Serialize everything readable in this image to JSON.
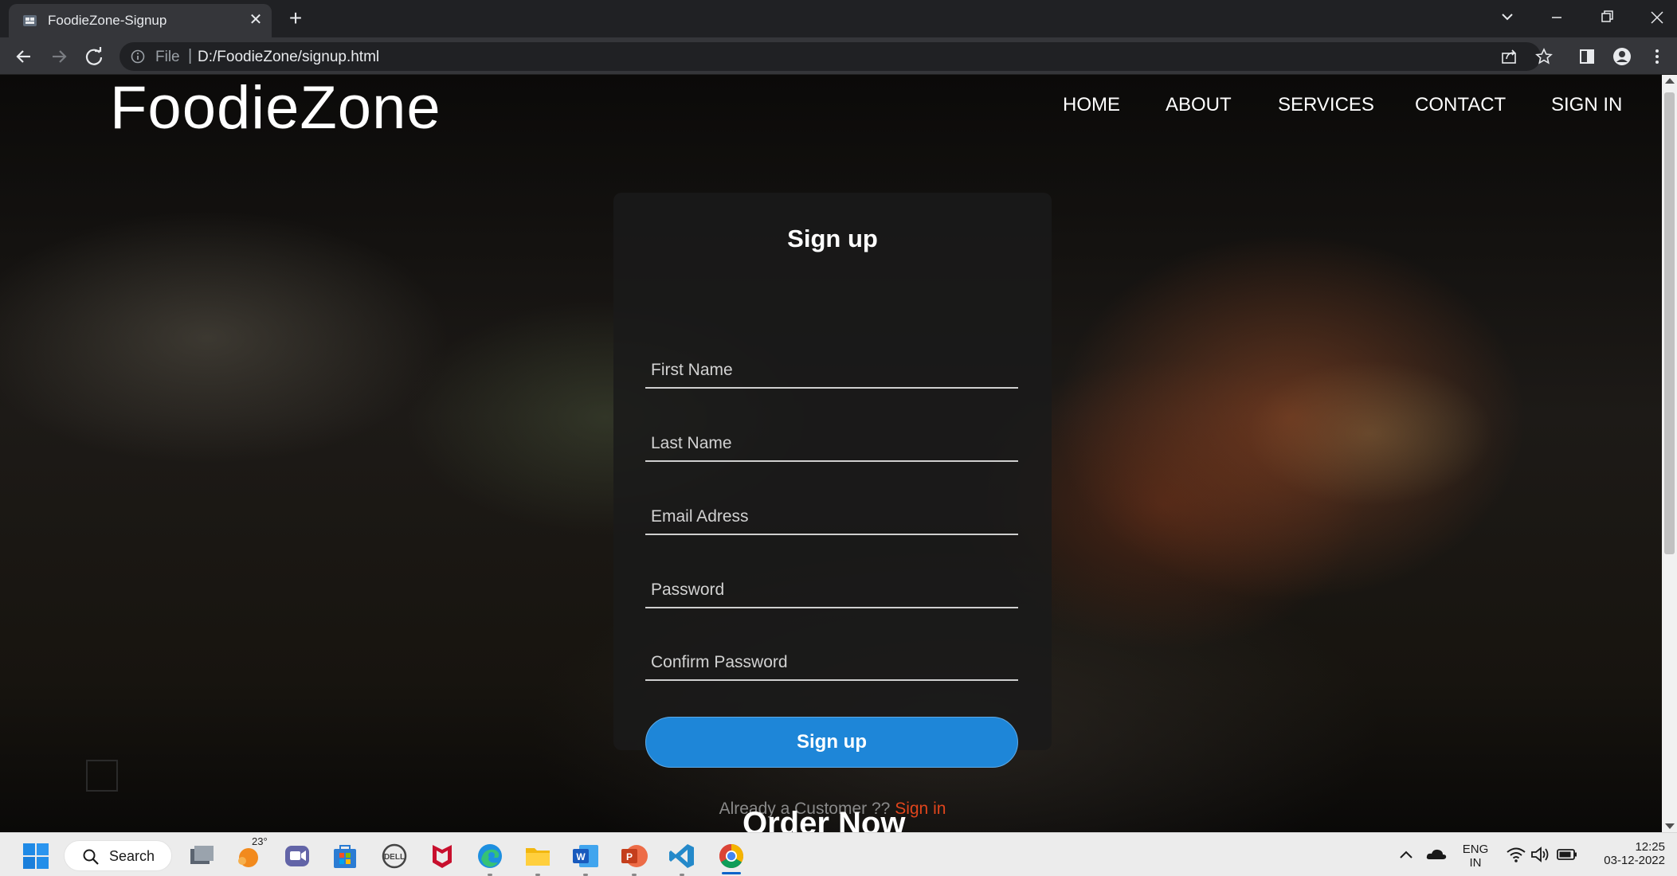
{
  "browser": {
    "tab_title": "FoodieZone-Signup",
    "address_scheme": "File",
    "address_separator": "|",
    "address_url": "D:/FoodieZone/signup.html"
  },
  "site": {
    "brand": "FoodieZone",
    "nav": [
      "HOME",
      "ABOUT",
      "SERVICES",
      "CONTACT",
      "SIGN IN"
    ]
  },
  "form": {
    "title": "Sign up",
    "fields": [
      {
        "placeholder": "First Name",
        "value": ""
      },
      {
        "placeholder": "Last Name",
        "value": ""
      },
      {
        "placeholder": "Email Adress",
        "value": ""
      },
      {
        "placeholder": "Password",
        "value": ""
      },
      {
        "placeholder": "Confirm Password",
        "value": ""
      }
    ],
    "submit_label": "Sign up",
    "footer_text": "Already a Customer ??",
    "footer_link": "Sign in"
  },
  "section_heading": "Order Now",
  "taskbar": {
    "search_label": "Search",
    "weather_temp": "23°",
    "language_line1": "ENG",
    "language_line2": "IN",
    "time": "12:25",
    "date": "03-12-2022"
  },
  "colors": {
    "primary_button": "#1e86d8",
    "signin_link": "#e0451c",
    "browser_dark": "#202124"
  }
}
